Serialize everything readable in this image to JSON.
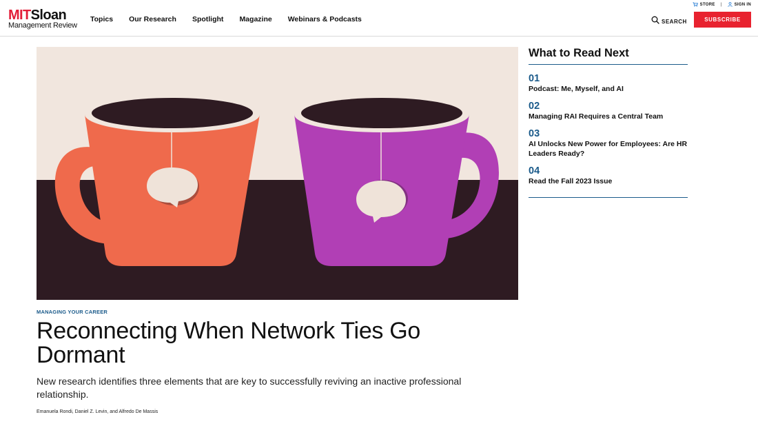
{
  "utility": {
    "store_label": "STORE",
    "separator": "|",
    "signin_label": "SIGN IN"
  },
  "logo": {
    "mit": "MIT",
    "sloan": "Sloan",
    "subtitle": "Management Review"
  },
  "nav": {
    "items": [
      {
        "label": "Topics"
      },
      {
        "label": "Our Research"
      },
      {
        "label": "Spotlight"
      },
      {
        "label": "Magazine"
      },
      {
        "label": "Webinars & Podcasts"
      }
    ]
  },
  "header": {
    "search_label": "SEARCH",
    "subscribe_label": "SUBSCRIBE"
  },
  "colors": {
    "brand_red": "#e21d38",
    "link_blue": "#1a5a8a",
    "mug_left": "#ef6a4c",
    "mug_right": "#b13fb5",
    "background_light": "#f1e6de",
    "background_dark": "#2e1b22"
  },
  "article": {
    "category": "MANAGING YOUR CAREER",
    "title": "Reconnecting When Network Ties Go Dormant",
    "dek": "New research identifies three elements that are key to successfully reviving an inactive professional relationship.",
    "byline": "Emanuela Rondi, Daniel Z. Levin, and Alfredo De Massis"
  },
  "sidebar": {
    "title": "What to Read Next",
    "items": [
      {
        "num": "01",
        "label": "Podcast: Me, Myself, and AI"
      },
      {
        "num": "02",
        "label": "Managing RAI Requires a Central Team"
      },
      {
        "num": "03",
        "label": "AI Unlocks New Power for Employees: Are HR Leaders Ready?"
      },
      {
        "num": "04",
        "label": "Read the Fall 2023 Issue"
      }
    ]
  }
}
